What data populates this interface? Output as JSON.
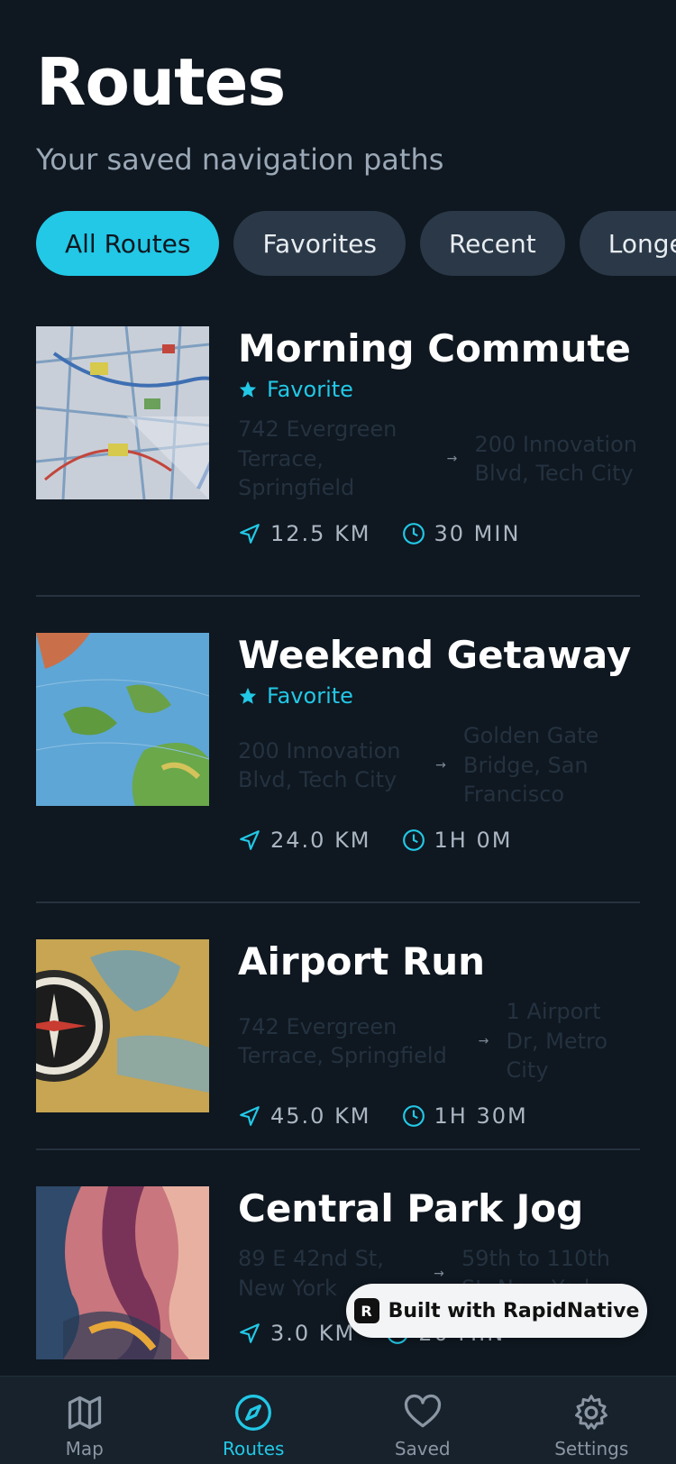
{
  "header": {
    "title": "Routes",
    "subtitle": "Your saved navigation paths"
  },
  "filters": [
    {
      "label": "All Routes",
      "active": true
    },
    {
      "label": "Favorites",
      "active": false
    },
    {
      "label": "Recent",
      "active": false
    },
    {
      "label": "Longest",
      "active": false
    }
  ],
  "routes": [
    {
      "name": "Morning Commute",
      "favorite_label": "Favorite",
      "from": "742 Evergreen Terrace, Springfield",
      "to": "200 Innovation Blvd, Tech City",
      "distance": "12.5 KM",
      "duration": "30 MIN"
    },
    {
      "name": "Weekend Getaway",
      "favorite_label": "Favorite",
      "from": "200 Innovation Blvd, Tech City",
      "to": "Golden Gate Bridge, San Francisco",
      "distance": "24.0 KM",
      "duration": "1H 0M"
    },
    {
      "name": "Airport Run",
      "from": "742 Evergreen Terrace, Springfield",
      "to": "1 Airport Dr, Metro City",
      "distance": "45.0 KM",
      "duration": "1H 30M"
    },
    {
      "name": "Central Park Jog",
      "from": "89 E 42nd St, New York",
      "to": "59th to 110th St, New York",
      "distance": "3.0 KM",
      "duration": "20 MIN"
    }
  ],
  "badge": {
    "label": "Built with RapidNative"
  },
  "tabs": [
    {
      "label": "Map",
      "icon": "map-icon"
    },
    {
      "label": "Routes",
      "icon": "compass-icon",
      "active": true
    },
    {
      "label": "Saved",
      "icon": "heart-icon"
    },
    {
      "label": "Settings",
      "icon": "gear-icon"
    }
  ],
  "colors": {
    "accent": "#22c8e6",
    "background": "#0f1720",
    "chip_inactive": "#2a3847"
  }
}
